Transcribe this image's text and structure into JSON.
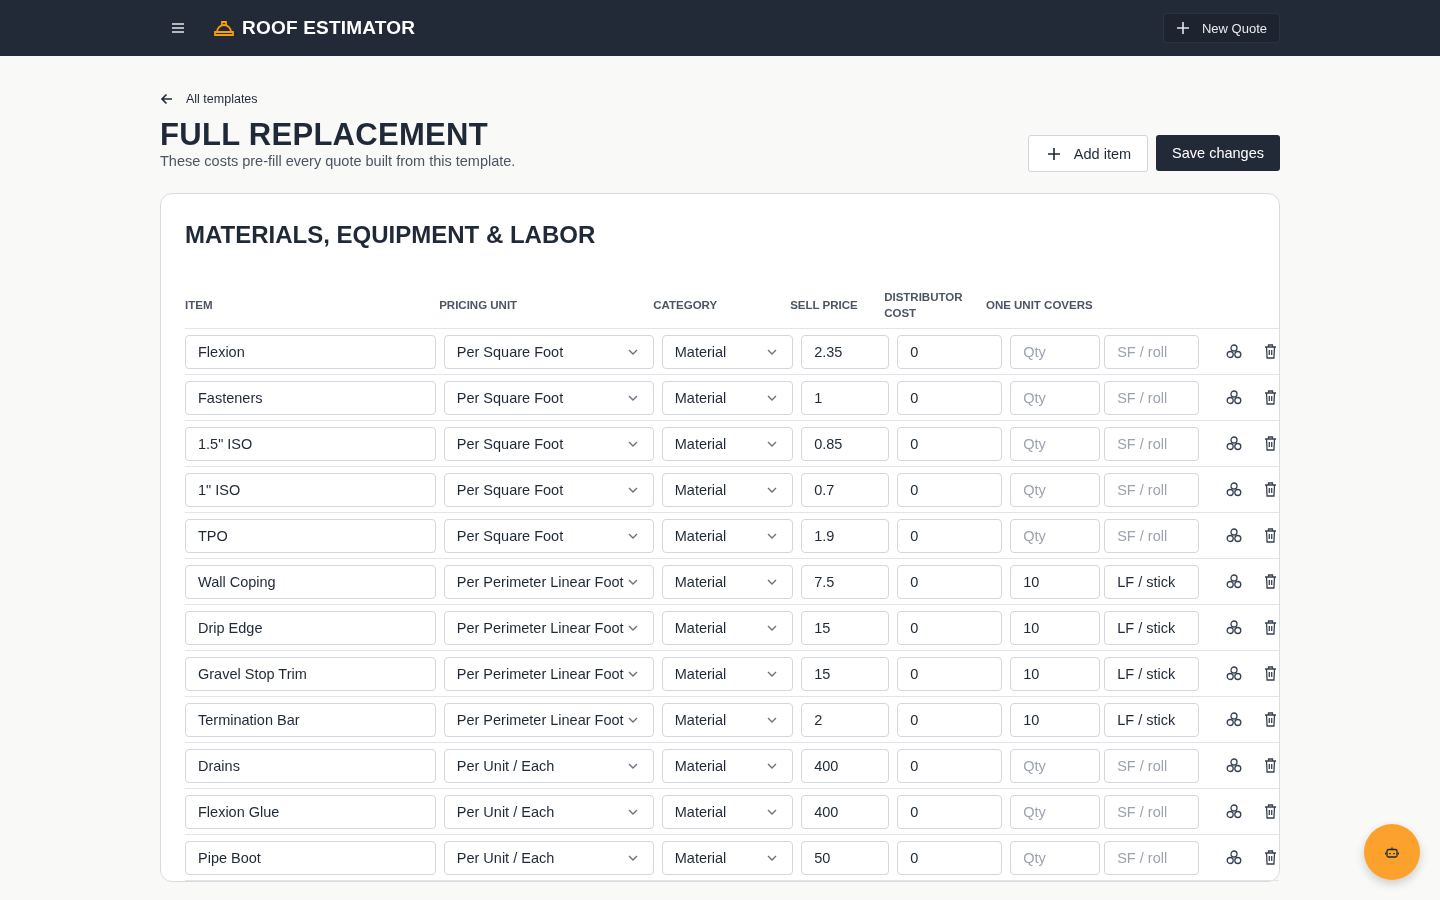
{
  "app": {
    "title": "ROOF ESTIMATOR",
    "new_quote": "New Quote"
  },
  "back_link": "All templates",
  "page": {
    "title": "FULL REPLACEMENT",
    "subtitle": "These costs pre-fill every quote built from this template.",
    "add_item": "Add item",
    "save": "Save changes"
  },
  "section": {
    "title": "MATERIALS, EQUIPMENT & LABOR",
    "columns": [
      "ITEM",
      "PRICING UNIT",
      "CATEGORY",
      "SELL PRICE",
      "DISTRIBUTOR COST",
      "ONE UNIT COVERS"
    ],
    "rows": [
      {
        "item": "Flexion",
        "pricing_unit": "Per Square Foot",
        "category": "Material",
        "sell_price": "2.35",
        "distributor_cost": "0",
        "covers_qty": {
          "placeholder": "Qty"
        },
        "covers_unit": {
          "placeholder": "SF / roll"
        }
      },
      {
        "item": "Fasteners",
        "pricing_unit": "Per Square Foot",
        "category": "Material",
        "sell_price": "1",
        "distributor_cost": "0",
        "covers_qty": {
          "placeholder": "Qty"
        },
        "covers_unit": {
          "placeholder": "SF / roll"
        }
      },
      {
        "item": "1.5\" ISO",
        "pricing_unit": "Per Square Foot",
        "category": "Material",
        "sell_price": "0.85",
        "distributor_cost": "0",
        "covers_qty": {
          "placeholder": "Qty"
        },
        "covers_unit": {
          "placeholder": "SF / roll"
        }
      },
      {
        "item": "1\" ISO",
        "pricing_unit": "Per Square Foot",
        "category": "Material",
        "sell_price": "0.7",
        "distributor_cost": "0",
        "covers_qty": {
          "placeholder": "Qty"
        },
        "covers_unit": {
          "placeholder": "SF / roll"
        }
      },
      {
        "item": "TPO",
        "pricing_unit": "Per Square Foot",
        "category": "Material",
        "sell_price": "1.9",
        "distributor_cost": "0",
        "covers_qty": {
          "placeholder": "Qty"
        },
        "covers_unit": {
          "placeholder": "SF / roll"
        }
      },
      {
        "item": "Wall Coping",
        "pricing_unit": "Per Perimeter Linear Foot",
        "category": "Material",
        "sell_price": "7.5",
        "distributor_cost": "0",
        "covers_qty": {
          "value": "10"
        },
        "covers_unit": {
          "value": "LF / stick"
        }
      },
      {
        "item": "Drip Edge",
        "pricing_unit": "Per Perimeter Linear Foot",
        "category": "Material",
        "sell_price": "15",
        "distributor_cost": "0",
        "covers_qty": {
          "value": "10"
        },
        "covers_unit": {
          "value": "LF / stick"
        }
      },
      {
        "item": "Gravel Stop Trim",
        "pricing_unit": "Per Perimeter Linear Foot",
        "category": "Material",
        "sell_price": "15",
        "distributor_cost": "0",
        "covers_qty": {
          "value": "10"
        },
        "covers_unit": {
          "value": "LF / stick"
        }
      },
      {
        "item": "Termination Bar",
        "pricing_unit": "Per Perimeter Linear Foot",
        "category": "Material",
        "sell_price": "2",
        "distributor_cost": "0",
        "covers_qty": {
          "value": "10"
        },
        "covers_unit": {
          "value": "LF / stick"
        }
      },
      {
        "item": "Drains",
        "pricing_unit": "Per Unit / Each",
        "category": "Material",
        "sell_price": "400",
        "distributor_cost": "0",
        "covers_qty": {
          "placeholder": "Qty"
        },
        "covers_unit": {
          "placeholder": "SF / roll"
        }
      },
      {
        "item": "Flexion Glue",
        "pricing_unit": "Per Unit / Each",
        "category": "Material",
        "sell_price": "400",
        "distributor_cost": "0",
        "covers_qty": {
          "placeholder": "Qty"
        },
        "covers_unit": {
          "placeholder": "SF / roll"
        }
      },
      {
        "item": "Pipe Boot",
        "pricing_unit": "Per Unit / Each",
        "category": "Material",
        "sell_price": "50",
        "distributor_cost": "0",
        "covers_qty": {
          "placeholder": "Qty"
        },
        "covers_unit": {
          "placeholder": "SF / roll"
        }
      }
    ]
  }
}
